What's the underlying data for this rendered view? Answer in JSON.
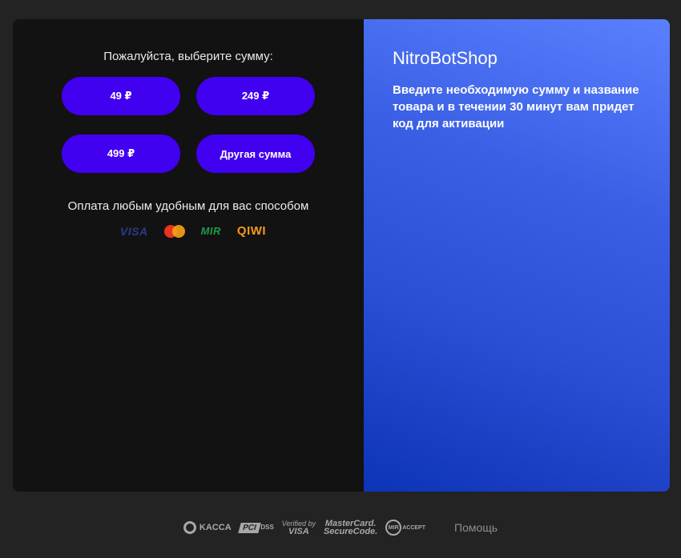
{
  "left": {
    "prompt": "Пожалуйста, выберите сумму:",
    "amounts": [
      "49 ₽",
      "249 ₽",
      "499 ₽",
      "Другая сумма"
    ],
    "payment_text": "Оплата любым удобным для вас способом",
    "payment_methods": {
      "visa": "VISA",
      "mastercard": "mastercard-icon",
      "mir": "MIR",
      "qiwi": "QIWI"
    }
  },
  "right": {
    "title": "NitroBotShop",
    "description": "Введите необходимую сумму и название товара и в течении 30 минут вам придет код для активации"
  },
  "footer": {
    "kassa": "KACCA",
    "pci": "PCI",
    "pci_dss": "DSS",
    "verified_top": "Verified by",
    "verified_bottom": "VISA",
    "mc_top": "MasterCard.",
    "mc_bottom": "SecureCode.",
    "mir_label": "MIR",
    "mir_accept": "ACCEPT",
    "help": "Помощь"
  },
  "colors": {
    "amount_button": "#4200f0",
    "panel_dark": "#121212",
    "gradient_top": "#5a80ff",
    "gradient_bottom": "#0d33b6"
  }
}
